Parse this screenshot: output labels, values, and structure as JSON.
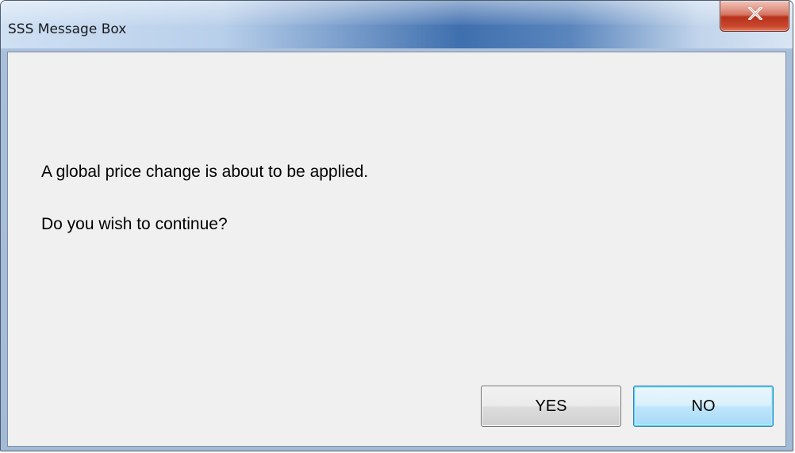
{
  "window": {
    "title": "SSS Message Box"
  },
  "message": {
    "line1": "A global price change is about to be applied.",
    "line2": "Do you wish to continue?"
  },
  "buttons": {
    "yes_label": "YES",
    "no_label": "NO"
  },
  "icons": {
    "close": "close-icon"
  },
  "colors": {
    "close_button": "#c9482d",
    "client_background": "#f0f0f0",
    "default_button_border": "#3c7fb1"
  }
}
